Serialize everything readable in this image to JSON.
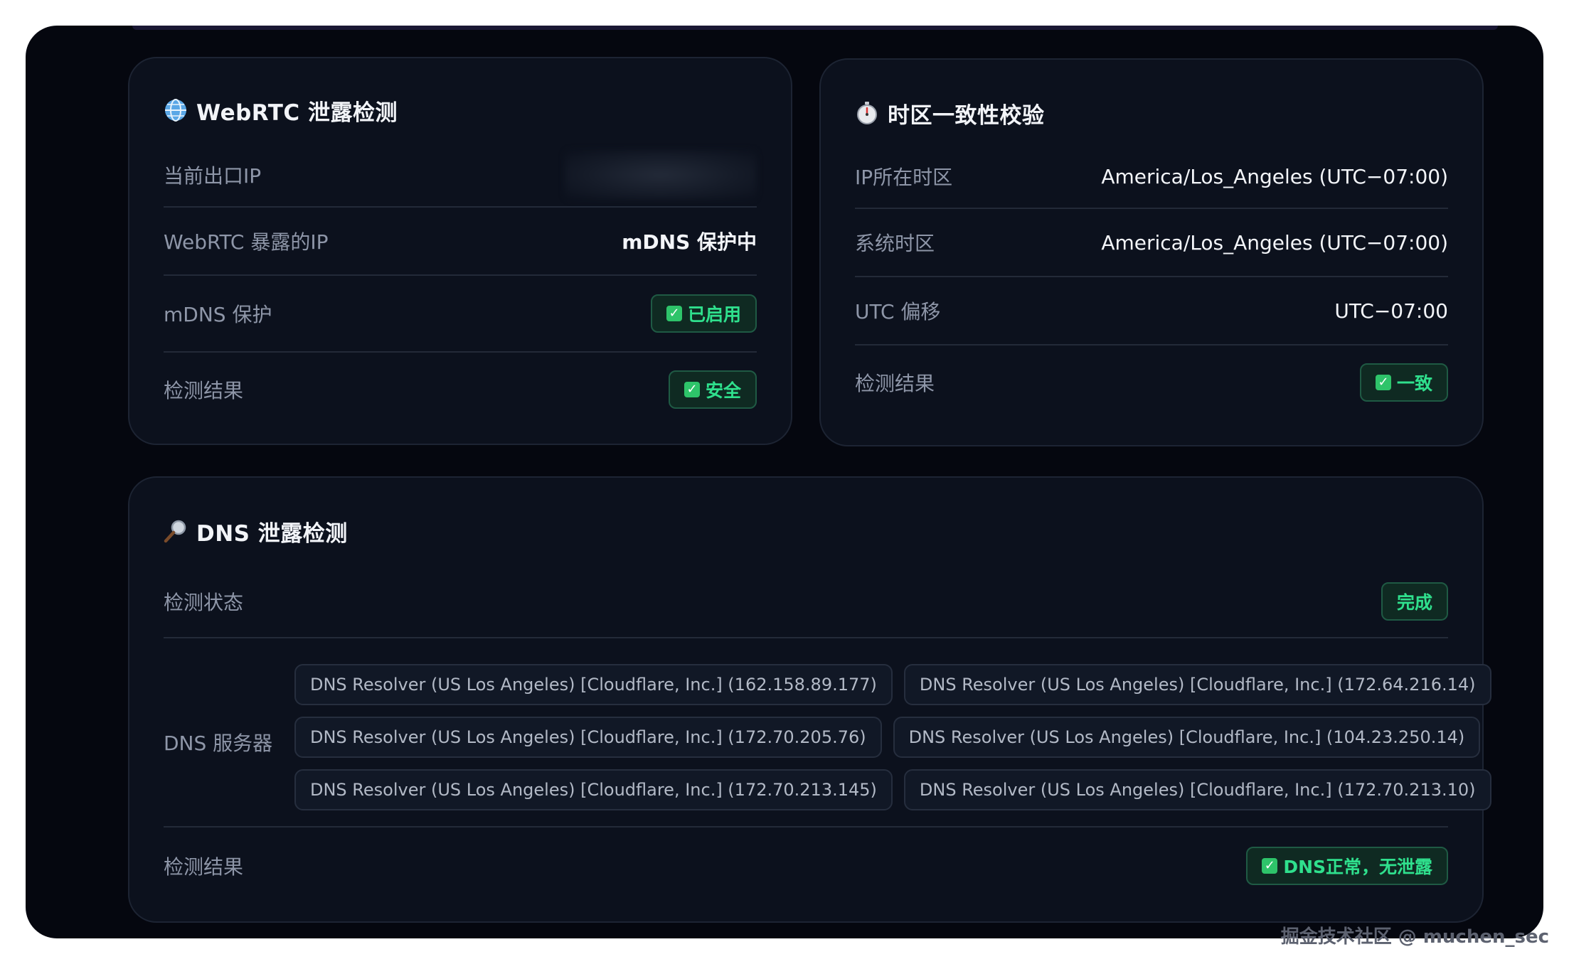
{
  "webrtc": {
    "title": "WebRTC 泄露检测",
    "icon": "globe-icon",
    "rows": [
      {
        "label": "当前出口IP",
        "value": ""
      },
      {
        "label": "WebRTC 暴露的IP",
        "value": "mDNS 保护中"
      },
      {
        "label": "mDNS 保护",
        "value": "已启用"
      },
      {
        "label": "检测结果",
        "value": "安全"
      }
    ]
  },
  "timezone": {
    "title": "时区一致性校验",
    "icon": "stopwatch-icon",
    "rows": [
      {
        "label": "IP所在时区",
        "value": "America/Los_Angeles (UTC−07:00)"
      },
      {
        "label": "系统时区",
        "value": "America/Los_Angeles (UTC−07:00)"
      },
      {
        "label": "UTC 偏移",
        "value": "UTC−07:00"
      },
      {
        "label": "检测结果",
        "value": "一致"
      }
    ]
  },
  "dns": {
    "title": "DNS 泄露检测",
    "icon": "magnifier-icon",
    "status_label": "检测状态",
    "status_value": "完成",
    "servers_label": "DNS 服务器",
    "servers": [
      "DNS Resolver (US Los Angeles) [Cloudflare, Inc.] (162.158.89.177)",
      "DNS Resolver (US Los Angeles) [Cloudflare, Inc.] (172.64.216.14)",
      "DNS Resolver (US Los Angeles) [Cloudflare, Inc.] (172.70.205.76)",
      "DNS Resolver (US Los Angeles) [Cloudflare, Inc.] (104.23.250.14)",
      "DNS Resolver (US Los Angeles) [Cloudflare, Inc.] (172.70.213.145)",
      "DNS Resolver (US Los Angeles) [Cloudflare, Inc.] (172.70.213.10)"
    ],
    "result_label": "检测结果",
    "result_value": "DNS正常，无泄露"
  },
  "watermark": "掘金技术社区 @ muchen_sec",
  "colors": {
    "background": "#05070f",
    "card": "#0c111d",
    "success_text": "#2fe08d",
    "success_bg": "#0f2a22",
    "check": "#2ec46a"
  }
}
